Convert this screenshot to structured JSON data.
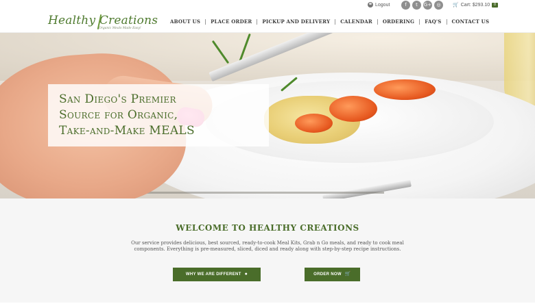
{
  "topbar": {
    "logout_label": "Logout",
    "user_icon": "user-icon",
    "social": [
      {
        "name": "facebook-icon",
        "glyph": "f"
      },
      {
        "name": "twitter-icon",
        "glyph": "t"
      },
      {
        "name": "google-plus-icon",
        "glyph": "G+"
      },
      {
        "name": "instagram-icon",
        "glyph": "◎"
      }
    ],
    "cart_label": "Cart: $293.10",
    "cart_count": "0",
    "cart_icon": "cart-icon"
  },
  "brand": {
    "logo_text": "Healthy Creations",
    "tagline": "Organic Meals Made Easy!"
  },
  "nav": {
    "items": [
      {
        "label": "ABOUT US"
      },
      {
        "label": "PLACE ORDER"
      },
      {
        "label": "PICKUP AND DELIVERY"
      },
      {
        "label": "CALENDAR"
      },
      {
        "label": "ORDERING"
      },
      {
        "label": "FAQ'S"
      },
      {
        "label": "CONTACT US"
      }
    ]
  },
  "hero": {
    "title": "San Diego's Premier\nSource for Organic,\nTake-and-Make MEALS"
  },
  "welcome": {
    "title": "WELCOME TO HEALTHY CREATIONS",
    "body": "Our service provides delicious, best sourced, ready-to-cook Meal Kits, Grab n Go meals, and ready to cook meal components. Everything is pre-measured, sliced, diced and ready along with step-by-step recipe instructions.",
    "buttons": {
      "different_label": "WHY WE ARE DIFFERENT",
      "different_icon": "chat-bubble-icon",
      "order_label": "ORDER NOW",
      "order_icon": "cart-icon"
    }
  },
  "colors": {
    "brand_green": "#4a6d2a",
    "nav_text": "#3a3a3a",
    "section_bg": "#f6f6f6"
  }
}
